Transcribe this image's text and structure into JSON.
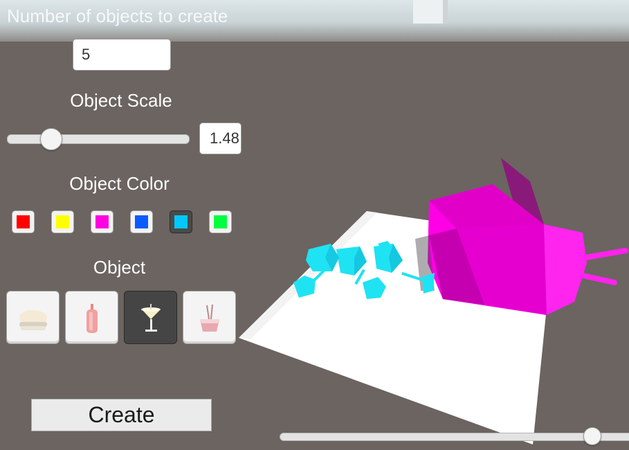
{
  "ui": {
    "count_label": "Number of objects to create",
    "count_value": "5",
    "scale_label": "Object Scale",
    "scale_value_text": "1.48",
    "scale_slider_level": 0.24,
    "color_label": "Object Color",
    "colors": [
      {
        "name": "red",
        "hex": "#ff0000",
        "selected": false
      },
      {
        "name": "yellow",
        "hex": "#ffff00",
        "selected": false
      },
      {
        "name": "magenta",
        "hex": "#ff00e0",
        "selected": false
      },
      {
        "name": "blue",
        "hex": "#0a5cff",
        "selected": false
      },
      {
        "name": "cyan",
        "hex": "#00c8ff",
        "selected": true
      },
      {
        "name": "green",
        "hex": "#00ff40",
        "selected": false
      }
    ],
    "object_label": "Object",
    "objects": [
      {
        "name": "burger-icon",
        "selected": false
      },
      {
        "name": "ketchup-bottle-icon",
        "selected": false
      },
      {
        "name": "cocktail-glass-icon",
        "selected": true
      },
      {
        "name": "noodle-box-icon",
        "selected": false
      }
    ],
    "create_label": "Create",
    "camera_slider_level": 0.88
  }
}
